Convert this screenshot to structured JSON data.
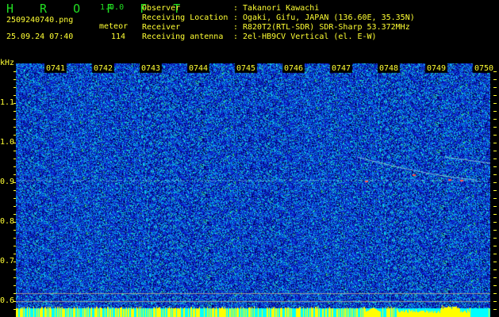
{
  "app": {
    "name": "H R O F F T",
    "version": "1.0.0"
  },
  "file": {
    "filename": "2509240740.png",
    "datetime": "25.09.24 07:40"
  },
  "detection": {
    "label": "meteor",
    "count": "114"
  },
  "station": {
    "rows": [
      {
        "label": "Observer",
        "sep": ":",
        "value": "Takanori Kawachi"
      },
      {
        "label": "Receiving Location",
        "sep": ":",
        "value": "Ogaki, Gifu, JAPAN (136.60E, 35.35N)"
      },
      {
        "label": "Receiver",
        "sep": ":",
        "value": "R820T2(RTL-SDR) SDR-Sharp 53.372MHz"
      },
      {
        "label": "Receiving antenna",
        "sep": ":",
        "value": "2el-HB9CV Vertical (el. E-W)"
      }
    ]
  },
  "axes": {
    "y_unit": "kHz",
    "y_ticks": [
      "1.1",
      "1.0",
      "0.9",
      "0.8",
      "0.7",
      "0.6"
    ],
    "x_ticks": [
      "0741",
      "0742",
      "0743",
      "0744",
      "0745",
      "0746",
      "0747",
      "0748",
      "0749",
      "0750"
    ]
  },
  "colors": {
    "text": "#ffff33",
    "logo": "#22dd22",
    "background": "#000000",
    "level_bar": "#00ffff",
    "level_peak": "#ffff00"
  }
}
